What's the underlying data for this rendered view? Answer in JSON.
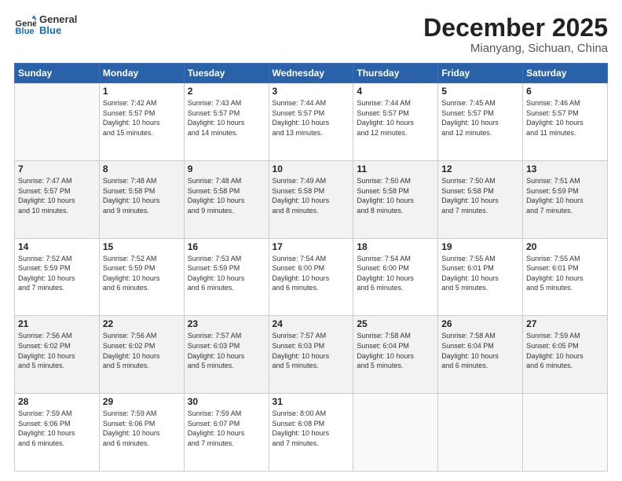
{
  "logo": {
    "line1": "General",
    "line2": "Blue"
  },
  "header": {
    "month": "December 2025",
    "location": "Mianyang, Sichuan, China"
  },
  "weekdays": [
    "Sunday",
    "Monday",
    "Tuesday",
    "Wednesday",
    "Thursday",
    "Friday",
    "Saturday"
  ],
  "weeks": [
    [
      {
        "day": "",
        "info": ""
      },
      {
        "day": "1",
        "info": "Sunrise: 7:42 AM\nSunset: 5:57 PM\nDaylight: 10 hours\nand 15 minutes."
      },
      {
        "day": "2",
        "info": "Sunrise: 7:43 AM\nSunset: 5:57 PM\nDaylight: 10 hours\nand 14 minutes."
      },
      {
        "day": "3",
        "info": "Sunrise: 7:44 AM\nSunset: 5:57 PM\nDaylight: 10 hours\nand 13 minutes."
      },
      {
        "day": "4",
        "info": "Sunrise: 7:44 AM\nSunset: 5:57 PM\nDaylight: 10 hours\nand 12 minutes."
      },
      {
        "day": "5",
        "info": "Sunrise: 7:45 AM\nSunset: 5:57 PM\nDaylight: 10 hours\nand 12 minutes."
      },
      {
        "day": "6",
        "info": "Sunrise: 7:46 AM\nSunset: 5:57 PM\nDaylight: 10 hours\nand 11 minutes."
      }
    ],
    [
      {
        "day": "7",
        "info": "Sunrise: 7:47 AM\nSunset: 5:57 PM\nDaylight: 10 hours\nand 10 minutes."
      },
      {
        "day": "8",
        "info": "Sunrise: 7:48 AM\nSunset: 5:58 PM\nDaylight: 10 hours\nand 9 minutes."
      },
      {
        "day": "9",
        "info": "Sunrise: 7:48 AM\nSunset: 5:58 PM\nDaylight: 10 hours\nand 9 minutes."
      },
      {
        "day": "10",
        "info": "Sunrise: 7:49 AM\nSunset: 5:58 PM\nDaylight: 10 hours\nand 8 minutes."
      },
      {
        "day": "11",
        "info": "Sunrise: 7:50 AM\nSunset: 5:58 PM\nDaylight: 10 hours\nand 8 minutes."
      },
      {
        "day": "12",
        "info": "Sunrise: 7:50 AM\nSunset: 5:58 PM\nDaylight: 10 hours\nand 7 minutes."
      },
      {
        "day": "13",
        "info": "Sunrise: 7:51 AM\nSunset: 5:59 PM\nDaylight: 10 hours\nand 7 minutes."
      }
    ],
    [
      {
        "day": "14",
        "info": "Sunrise: 7:52 AM\nSunset: 5:59 PM\nDaylight: 10 hours\nand 7 minutes."
      },
      {
        "day": "15",
        "info": "Sunrise: 7:52 AM\nSunset: 5:59 PM\nDaylight: 10 hours\nand 6 minutes."
      },
      {
        "day": "16",
        "info": "Sunrise: 7:53 AM\nSunset: 5:59 PM\nDaylight: 10 hours\nand 6 minutes."
      },
      {
        "day": "17",
        "info": "Sunrise: 7:54 AM\nSunset: 6:00 PM\nDaylight: 10 hours\nand 6 minutes."
      },
      {
        "day": "18",
        "info": "Sunrise: 7:54 AM\nSunset: 6:00 PM\nDaylight: 10 hours\nand 6 minutes."
      },
      {
        "day": "19",
        "info": "Sunrise: 7:55 AM\nSunset: 6:01 PM\nDaylight: 10 hours\nand 5 minutes."
      },
      {
        "day": "20",
        "info": "Sunrise: 7:55 AM\nSunset: 6:01 PM\nDaylight: 10 hours\nand 5 minutes."
      }
    ],
    [
      {
        "day": "21",
        "info": "Sunrise: 7:56 AM\nSunset: 6:02 PM\nDaylight: 10 hours\nand 5 minutes."
      },
      {
        "day": "22",
        "info": "Sunrise: 7:56 AM\nSunset: 6:02 PM\nDaylight: 10 hours\nand 5 minutes."
      },
      {
        "day": "23",
        "info": "Sunrise: 7:57 AM\nSunset: 6:03 PM\nDaylight: 10 hours\nand 5 minutes."
      },
      {
        "day": "24",
        "info": "Sunrise: 7:57 AM\nSunset: 6:03 PM\nDaylight: 10 hours\nand 5 minutes."
      },
      {
        "day": "25",
        "info": "Sunrise: 7:58 AM\nSunset: 6:04 PM\nDaylight: 10 hours\nand 5 minutes."
      },
      {
        "day": "26",
        "info": "Sunrise: 7:58 AM\nSunset: 6:04 PM\nDaylight: 10 hours\nand 6 minutes."
      },
      {
        "day": "27",
        "info": "Sunrise: 7:59 AM\nSunset: 6:05 PM\nDaylight: 10 hours\nand 6 minutes."
      }
    ],
    [
      {
        "day": "28",
        "info": "Sunrise: 7:59 AM\nSunset: 6:06 PM\nDaylight: 10 hours\nand 6 minutes."
      },
      {
        "day": "29",
        "info": "Sunrise: 7:59 AM\nSunset: 6:06 PM\nDaylight: 10 hours\nand 6 minutes."
      },
      {
        "day": "30",
        "info": "Sunrise: 7:59 AM\nSunset: 6:07 PM\nDaylight: 10 hours\nand 7 minutes."
      },
      {
        "day": "31",
        "info": "Sunrise: 8:00 AM\nSunset: 6:08 PM\nDaylight: 10 hours\nand 7 minutes."
      },
      {
        "day": "",
        "info": ""
      },
      {
        "day": "",
        "info": ""
      },
      {
        "day": "",
        "info": ""
      }
    ]
  ]
}
